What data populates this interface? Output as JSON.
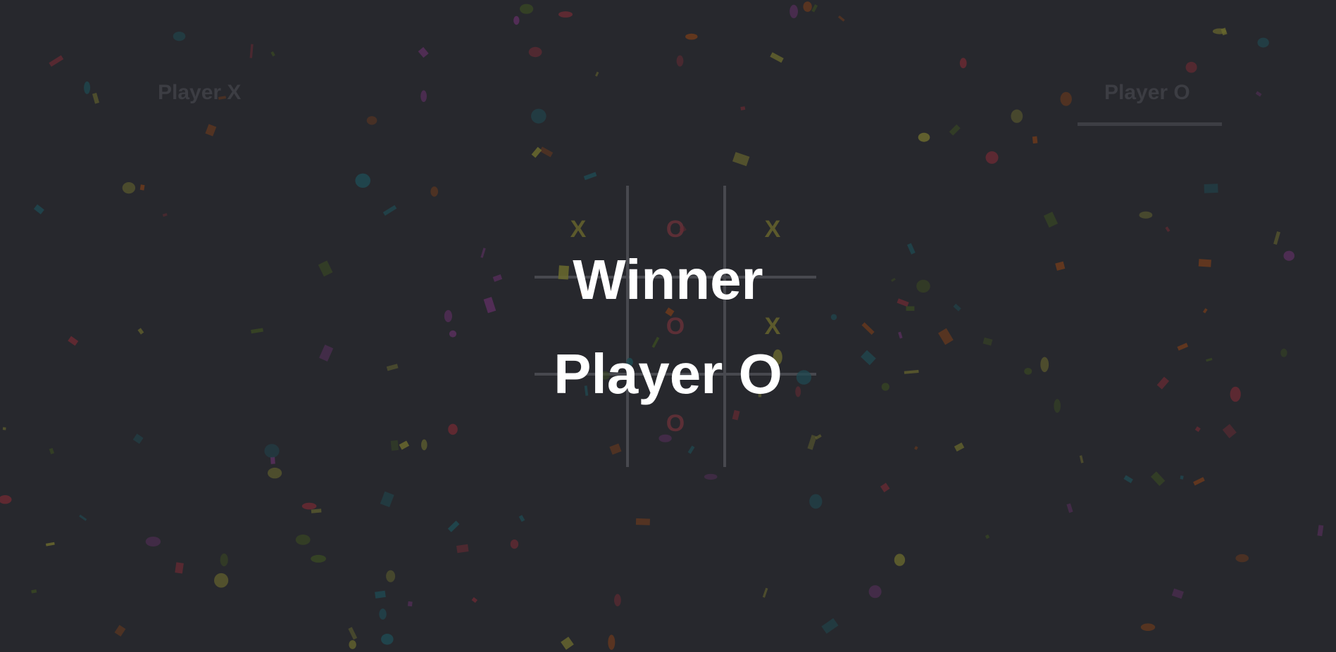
{
  "players": {
    "x_label": "Player X",
    "o_label": "Player O",
    "active": "O"
  },
  "board": {
    "cells": [
      "X",
      "O",
      "X",
      "",
      "O",
      "X",
      "",
      "O",
      ""
    ]
  },
  "result": {
    "title": "Winner",
    "name": "Player O"
  },
  "colors": {
    "background": "#27282d",
    "x_mark": "#5c5a2c",
    "o_mark": "#5c2f36",
    "winner_text": "#ffffff",
    "confetti": [
      "#6b6a2e",
      "#6e3a1c",
      "#6b2a33",
      "#1f4a52",
      "#5a2f5e",
      "#3a4a22"
    ]
  }
}
